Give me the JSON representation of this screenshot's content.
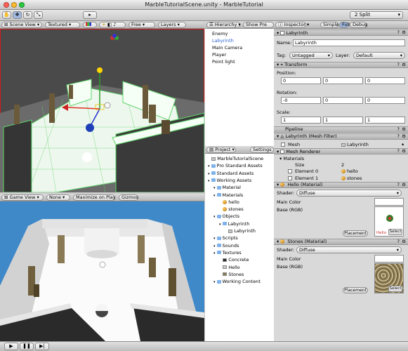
{
  "window": {
    "title": "MarbleTutorialScene.unity - MarbleTutorial"
  },
  "toolbar": {
    "layout_select": "2 Split"
  },
  "scene_view": {
    "tab": "Scene View",
    "shading": "Textured",
    "camera": "Free",
    "layers": "Layers"
  },
  "game_view": {
    "tab": "Game View",
    "aspect": "None",
    "maximize": "Maximize on Play",
    "gizmos": "Gizmos"
  },
  "hierarchy": {
    "tab": "Hierarchy",
    "show_prefabs": "Show Pre",
    "items": [
      "Enemy",
      "Labyrinth",
      "Main Camera",
      "Player",
      "Point light"
    ],
    "selected_index": 1
  },
  "project": {
    "tab": "Project",
    "settings": "Settings",
    "items": [
      {
        "label": "MarbleTutorialScene",
        "icon": "unity-scene-icon",
        "indent": 0
      },
      {
        "label": "Pro Standard Assets",
        "icon": "folder-icon",
        "indent": 0
      },
      {
        "label": "Standard Assets",
        "icon": "folder-icon",
        "indent": 0
      },
      {
        "label": "Working Assets",
        "icon": "folder-icon",
        "indent": 0
      },
      {
        "label": "Material",
        "icon": "folder-icon",
        "indent": 1
      },
      {
        "label": "Materials",
        "icon": "folder-icon",
        "indent": 1
      },
      {
        "label": "hello",
        "icon": "material-ball-icon",
        "indent": 2
      },
      {
        "label": "stones",
        "icon": "material-ball-icon",
        "indent": 2
      },
      {
        "label": "Objects",
        "icon": "folder-icon",
        "indent": 1
      },
      {
        "label": "Labyrinth",
        "icon": "prefab-icon",
        "indent": 2
      },
      {
        "label": "Labyrinth",
        "icon": "mesh-icon",
        "indent": 3
      },
      {
        "label": "Scripts",
        "icon": "folder-icon",
        "indent": 1
      },
      {
        "label": "Sounds",
        "icon": "folder-icon",
        "indent": 1
      },
      {
        "label": "Textures",
        "icon": "folder-icon",
        "indent": 1
      },
      {
        "label": "Concrete",
        "icon": "texture-icon",
        "indent": 2
      },
      {
        "label": "Hello",
        "icon": "texture-icon",
        "indent": 2
      },
      {
        "label": "Stones",
        "icon": "texture-icon",
        "indent": 2
      },
      {
        "label": "Working Content",
        "icon": "folder-icon",
        "indent": 1
      }
    ]
  },
  "inspector": {
    "tab": "Inspector",
    "mode_simple": "Simple",
    "mode_full": "Full",
    "mode_debug": "Debug",
    "object_name_header": "Labyrinth",
    "name_label": "Name:",
    "name_value": "Labyrinth",
    "tag_label": "Tag:",
    "tag_value": "Untagged",
    "layer_label": "Layer:",
    "layer_value": "Default",
    "transform": {
      "title": "Transform",
      "position_label": "Position:",
      "position": [
        "0",
        "0",
        "0"
      ],
      "rotation_label": "Rotation:",
      "rotation": [
        "-0",
        "0",
        "0"
      ],
      "scale_label": "Scale:",
      "scale": [
        "1",
        "1",
        "1"
      ]
    },
    "pipeline": "Pipeline",
    "mesh_filter": {
      "title": "Labyrinth (Mesh Filter)",
      "mesh_label": "Mesh",
      "mesh_value": "Labyrinth"
    },
    "mesh_renderer": {
      "title": "Mesh Renderer",
      "materials": "Materials",
      "size_label": "Size",
      "size_value": "2",
      "elem0_label": "Element 0",
      "elem0_value": "hello",
      "elem1_label": "Element 1",
      "elem1_value": "stones"
    },
    "hello_material": {
      "title": "Hello (Material)",
      "shader_label": "Shader:",
      "shader_value": "Diffuse",
      "main_color": "Main Color",
      "base": "Base (RGB)",
      "placement": "Placement",
      "select": "Select",
      "thumb_text": "Hello"
    },
    "stones_material": {
      "title": "Stones (Material)",
      "shader_label": "Shader:",
      "shader_value": "Diffuse",
      "main_color": "Main Color",
      "base": "Base (RGB)",
      "placement": "Placement",
      "select": "Select"
    },
    "qm": "?"
  },
  "colors": {
    "scene_border": "#d11d1d",
    "game_sky": "#3f89c9",
    "grid_green": "#5fd56a",
    "wall_dark": "#3a3a3a",
    "floor_white": "#f2f2f2",
    "selection_blue": "#2a5fd0"
  }
}
